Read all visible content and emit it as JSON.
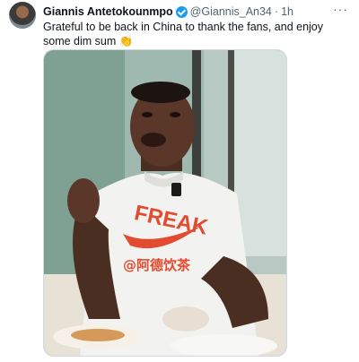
{
  "tweet": {
    "author_name": "Giannis Antetokounmpo",
    "handle": "@Giannis_An34",
    "separator": "·",
    "time": "1h",
    "more_label": "···",
    "text_line1": "Grateful to be back in China to thank the fans, and enjoy some dim sum 👏",
    "text_line2": "👏🥢🙌",
    "shirt_text": "FREAK",
    "shirt_sub": "@阿德饮茶"
  }
}
